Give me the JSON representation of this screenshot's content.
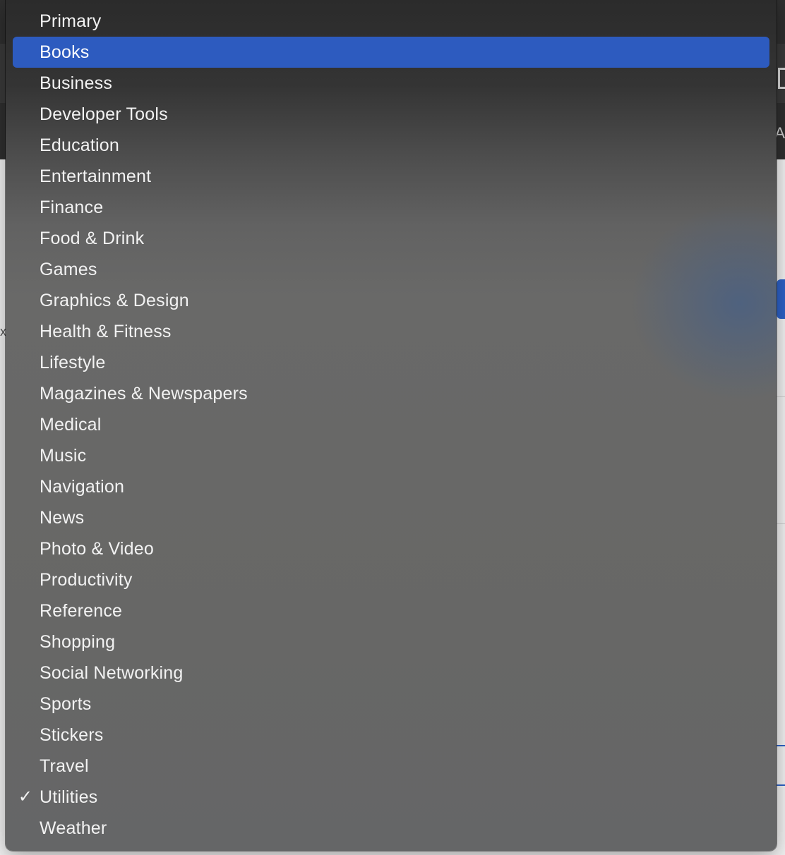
{
  "menu": {
    "items": [
      {
        "label": "Primary",
        "highlighted": false,
        "checked": false
      },
      {
        "label": "Books",
        "highlighted": true,
        "checked": false
      },
      {
        "label": "Business",
        "highlighted": false,
        "checked": false
      },
      {
        "label": "Developer Tools",
        "highlighted": false,
        "checked": false
      },
      {
        "label": "Education",
        "highlighted": false,
        "checked": false
      },
      {
        "label": "Entertainment",
        "highlighted": false,
        "checked": false
      },
      {
        "label": "Finance",
        "highlighted": false,
        "checked": false
      },
      {
        "label": "Food & Drink",
        "highlighted": false,
        "checked": false
      },
      {
        "label": "Games",
        "highlighted": false,
        "checked": false
      },
      {
        "label": "Graphics & Design",
        "highlighted": false,
        "checked": false
      },
      {
        "label": "Health & Fitness",
        "highlighted": false,
        "checked": false
      },
      {
        "label": "Lifestyle",
        "highlighted": false,
        "checked": false
      },
      {
        "label": "Magazines & Newspapers",
        "highlighted": false,
        "checked": false
      },
      {
        "label": "Medical",
        "highlighted": false,
        "checked": false
      },
      {
        "label": "Music",
        "highlighted": false,
        "checked": false
      },
      {
        "label": "Navigation",
        "highlighted": false,
        "checked": false
      },
      {
        "label": "News",
        "highlighted": false,
        "checked": false
      },
      {
        "label": "Photo & Video",
        "highlighted": false,
        "checked": false
      },
      {
        "label": "Productivity",
        "highlighted": false,
        "checked": false
      },
      {
        "label": "Reference",
        "highlighted": false,
        "checked": false
      },
      {
        "label": "Shopping",
        "highlighted": false,
        "checked": false
      },
      {
        "label": "Social Networking",
        "highlighted": false,
        "checked": false
      },
      {
        "label": "Sports",
        "highlighted": false,
        "checked": false
      },
      {
        "label": "Stickers",
        "highlighted": false,
        "checked": false
      },
      {
        "label": "Travel",
        "highlighted": false,
        "checked": false
      },
      {
        "label": "Utilities",
        "highlighted": false,
        "checked": true
      },
      {
        "label": "Weather",
        "highlighted": false,
        "checked": false
      }
    ],
    "checkmark_glyph": "✓",
    "highlight_color": "#2d5bbf"
  },
  "background": {
    "glyph_a": "A",
    "glyph_x": "x"
  }
}
